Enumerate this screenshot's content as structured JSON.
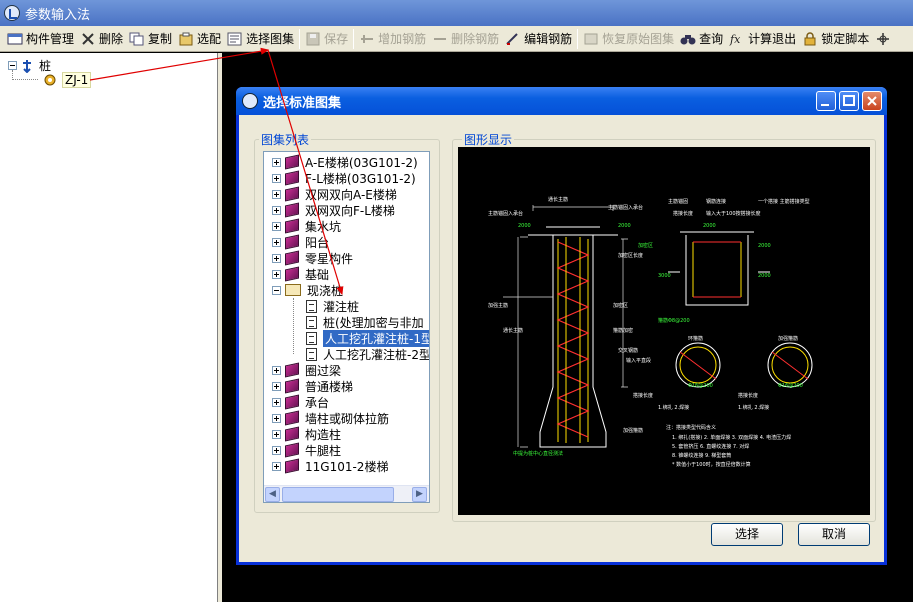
{
  "window": {
    "title": "参数输入法"
  },
  "toolbar": {
    "items": [
      {
        "label": "构件管理",
        "icon": "component-manage-icon",
        "enabled": true
      },
      {
        "label": "删除",
        "icon": "delete-x-icon",
        "enabled": true
      },
      {
        "label": "复制",
        "icon": "copy-icon",
        "enabled": true
      },
      {
        "label": "选配",
        "icon": "select-match-icon",
        "enabled": true
      },
      {
        "label": "选择图集",
        "icon": "atlas-icon",
        "enabled": true
      },
      {
        "label": "保存",
        "icon": "save-icon",
        "enabled": false
      },
      {
        "label": "增加钢筋",
        "icon": "add-rebar-icon",
        "enabled": false
      },
      {
        "label": "删除钢筋",
        "icon": "delete-rebar-icon",
        "enabled": false
      },
      {
        "label": "编辑钢筋",
        "icon": "edit-rebar-icon",
        "enabled": true
      },
      {
        "label": "恢复原始图集",
        "icon": "restore-atlas-icon",
        "enabled": false
      },
      {
        "label": "查询",
        "icon": "binoculars-icon",
        "enabled": true
      },
      {
        "label": "计算退出",
        "icon": "fx-icon",
        "enabled": true
      },
      {
        "label": "锁定脚本",
        "icon": "lock-icon",
        "enabled": true
      }
    ]
  },
  "left_tree": {
    "root": "桩",
    "child": "ZJ-1"
  },
  "dialog": {
    "title": "选择标准图集",
    "list_group_label": "图集列表",
    "preview_group_label": "图形显示",
    "items": [
      {
        "label": "A-E楼梯(03G101-2)",
        "type": "book",
        "expander": "plus"
      },
      {
        "label": "F-L楼梯(03G101-2)",
        "type": "book",
        "expander": "plus"
      },
      {
        "label": "双网双向A-E楼梯",
        "type": "book",
        "expander": "plus"
      },
      {
        "label": "双网双向F-L楼梯",
        "type": "book",
        "expander": "plus"
      },
      {
        "label": "集水坑",
        "type": "book",
        "expander": "plus"
      },
      {
        "label": "阳台",
        "type": "book",
        "expander": "plus"
      },
      {
        "label": "零星构件",
        "type": "book",
        "expander": "plus"
      },
      {
        "label": "基础",
        "type": "book",
        "expander": "plus"
      },
      {
        "label": "现浇桩",
        "type": "openbook",
        "expander": "minus"
      },
      {
        "label": "灌注桩",
        "type": "doc",
        "expander": "none"
      },
      {
        "label": "桩(处理加密与非加",
        "type": "doc",
        "expander": "none"
      },
      {
        "label": "人工挖孔灌注桩-1型",
        "type": "doc",
        "expander": "none",
        "selected": true
      },
      {
        "label": "人工挖孔灌注桩-2型",
        "type": "doc",
        "expander": "none"
      },
      {
        "label": "圈过梁",
        "type": "book",
        "expander": "plus"
      },
      {
        "label": "普通楼梯",
        "type": "book",
        "expander": "plus"
      },
      {
        "label": "承台",
        "type": "book",
        "expander": "plus"
      },
      {
        "label": "墙柱或砌体拉筋",
        "type": "book",
        "expander": "plus"
      },
      {
        "label": "构造柱",
        "type": "book",
        "expander": "plus"
      },
      {
        "label": "牛腿柱",
        "type": "book",
        "expander": "plus"
      },
      {
        "label": "11G101-2楼梯",
        "type": "book",
        "expander": "plus"
      }
    ],
    "select_button": "选择",
    "cancel_button": "取消",
    "preview": {
      "notes_title": "注：搭接类型代码含义",
      "notes": [
        "1. 绑扎(搭接)  2. 单面焊接  3. 双面焊接  4. 电渣压力焊",
        "5. 套管挤压  6. 直螺纹连接  7. 对焊",
        "8. 锥螺纹连接  9. 梯型套筒",
        "* 数值小于100时，按直径倍数计算"
      ],
      "caption": "中提为桩中心直径测法"
    }
  },
  "colors": {
    "accent": "#0a5fe0",
    "selection": "#316ac5",
    "group_label": "#0046d5",
    "annotation_arrow": "#e00000"
  }
}
